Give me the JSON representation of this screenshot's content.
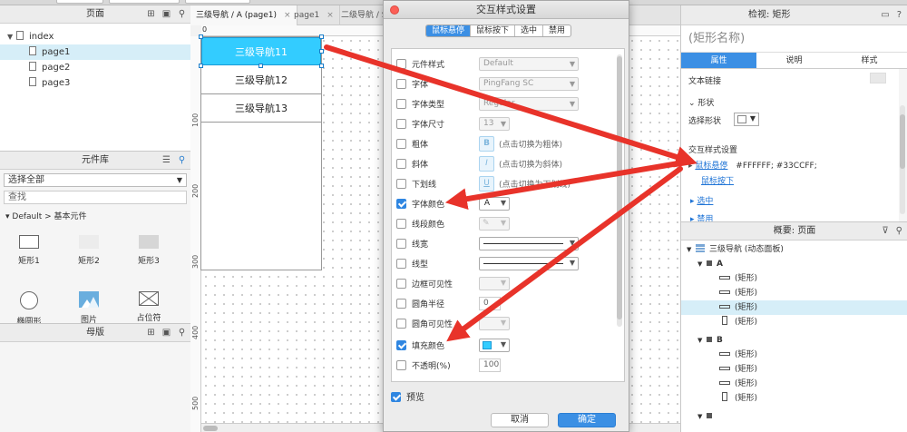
{
  "colors": {
    "accent": "#3b8fe4",
    "hover_fill": "#33ccff",
    "arrow": "#e8332a"
  },
  "pages_panel": {
    "title": "页面",
    "items": [
      {
        "label": "index",
        "level": 0
      },
      {
        "label": "page1",
        "level": 1,
        "selected": true
      },
      {
        "label": "page2",
        "level": 1
      },
      {
        "label": "page3",
        "level": 1
      }
    ]
  },
  "library_panel": {
    "title": "元件库",
    "select_all": "选择全部",
    "search_placeholder": "查找",
    "category": "Default > 基本元件",
    "widgets": [
      "矩形1",
      "矩形2",
      "矩形3",
      "椭圆形",
      "图片",
      "占位符"
    ]
  },
  "master_panel": {
    "title": "母版"
  },
  "canvas": {
    "tabs": [
      "三级导航 / A (page1)",
      "page1",
      "二级导航 / S"
    ],
    "ruler_top": [
      "0",
      "100",
      "200",
      "300",
      "400",
      "500"
    ],
    "ruler_left": [
      "100",
      "200",
      "300",
      "400",
      "500"
    ],
    "nav_items": [
      "三级导航11",
      "三级导航12",
      "三级导航13"
    ]
  },
  "dialog": {
    "title": "交互样式设置",
    "segments": [
      "鼠标悬停",
      "鼠标按下",
      "选中",
      "禁用"
    ],
    "properties": {
      "style": {
        "label": "元件样式",
        "value": "Default"
      },
      "font": {
        "label": "字体",
        "value": "PingFang SC"
      },
      "font_type": {
        "label": "字体类型",
        "value": "Regular"
      },
      "font_size": {
        "label": "字体尺寸",
        "value": "13"
      },
      "bold": {
        "label": "粗体",
        "hint": "(点击切换为粗体)",
        "icon": "B"
      },
      "italic": {
        "label": "斜体",
        "hint": "(点击切换为斜体)",
        "icon": "I"
      },
      "underline": {
        "label": "下划线",
        "hint": "(点击切换为下划线)",
        "icon": "U"
      },
      "font_color": {
        "label": "字体颜色",
        "icon": "A",
        "checked": true
      },
      "line_color": {
        "label": "线段颜色"
      },
      "line_width": {
        "label": "线宽"
      },
      "line_type": {
        "label": "线型"
      },
      "border_visible": {
        "label": "边框可见性"
      },
      "corner_radius": {
        "label": "圆角半径",
        "value": "0"
      },
      "corner_visible": {
        "label": "圆角可见性"
      },
      "fill_color": {
        "label": "填充颜色",
        "checked": true,
        "swatch": "#33ccff"
      },
      "opacity": {
        "label": "不透明(%)",
        "value": "100"
      }
    },
    "preview": "预览",
    "cancel": "取消",
    "ok": "确定"
  },
  "inspector": {
    "title": "检视: 矩形",
    "shape_name": "(矩形名称)",
    "tabs": [
      "属性",
      "说明",
      "样式"
    ],
    "text_link": "文本链接",
    "shape_section": "形状",
    "select_shape": "选择形状",
    "interaction_styles": "交互样式设置",
    "hover_link": "鼠标悬停",
    "hover_value": "#FFFFFF; #33CCFF;",
    "mousedown_link": "鼠标按下",
    "selected_link": "选中",
    "disabled_link": "禁用"
  },
  "outline": {
    "title": "概要: 页面",
    "root": "三级导航 (动态面板)",
    "state_a": "A",
    "state_b": "B",
    "item": "(矩形)"
  }
}
